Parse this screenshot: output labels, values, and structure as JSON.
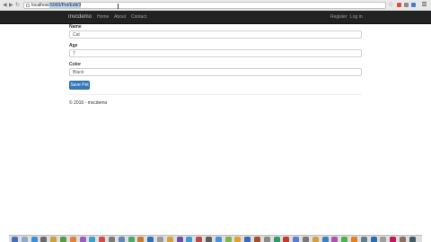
{
  "browser": {
    "url_host": "localhost",
    "url_rest": ":5000/Pet/Edit/3"
  },
  "navbar": {
    "brand": "mvcdemo",
    "links": [
      "Home",
      "About",
      "Contact"
    ],
    "right_links": [
      "Register",
      "Log in"
    ]
  },
  "form": {
    "fields": [
      {
        "label": "Name",
        "value": "Cat"
      },
      {
        "label": "Age",
        "value": "7"
      },
      {
        "label": "Color",
        "value": "Black"
      }
    ],
    "save_label": "Save Pet"
  },
  "footer": {
    "text": "© 2016 - mvcdemo"
  },
  "colors": {
    "navbar_bg": "#222222",
    "primary_button": "#337ab7"
  },
  "dock": {
    "icon_colors": [
      "#4a6fb5",
      "#8fa9c9",
      "#3b8fd9",
      "#6a6a6a",
      "#c8a23a",
      "#5b9a3f",
      "#e2823a",
      "#9c5db8",
      "#3aa0c8",
      "#d24b4b",
      "#7a7a7a",
      "#5f88b8",
      "#4aa868",
      "#c77b2f",
      "#2f6fb5",
      "#9a9a9a",
      "#d6a23c",
      "#6c4ea8",
      "#3c9bd4",
      "#b84a4a",
      "#5c5c5c",
      "#4a8fd9",
      "#7fb64a",
      "#e0a030",
      "#3a6ab5",
      "#a05030",
      "#8a8a8a",
      "#2e9a6a",
      "#c0392b",
      "#5a7bd0",
      "#777777",
      "#d0a040",
      "#3f7fbf",
      "#aa55aa",
      "#4caf50",
      "#e67e22",
      "#607d8b",
      "#2b6cb0",
      "#9e9e9e",
      "#c2185b",
      "#8d6e63",
      "#455a64"
    ]
  }
}
